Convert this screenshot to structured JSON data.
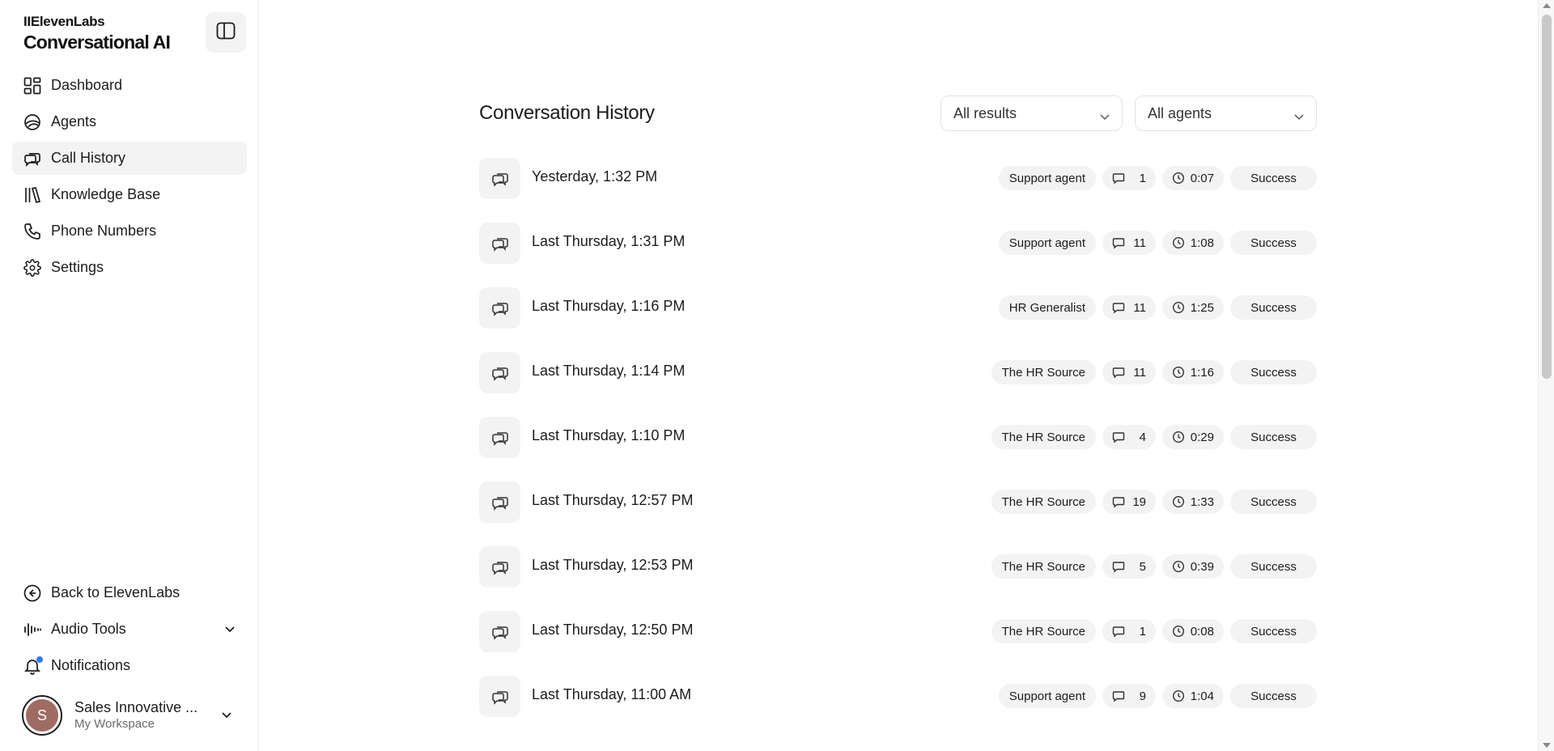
{
  "sidebar": {
    "brand_logo": "IIElevenLabs",
    "brand_product": "Conversational AI",
    "nav": [
      {
        "label": "Dashboard",
        "icon": "dashboard-icon",
        "active": false
      },
      {
        "label": "Agents",
        "icon": "agents-icon",
        "active": false
      },
      {
        "label": "Call History",
        "icon": "call-history-icon",
        "active": true
      },
      {
        "label": "Knowledge Base",
        "icon": "knowledge-base-icon",
        "active": false
      },
      {
        "label": "Phone Numbers",
        "icon": "phone-icon",
        "active": false
      },
      {
        "label": "Settings",
        "icon": "gear-icon",
        "active": false
      }
    ],
    "bottom": {
      "back": "Back to ElevenLabs",
      "audio_tools": "Audio Tools",
      "notifications": "Notifications"
    },
    "account": {
      "initial": "S",
      "name": "Sales Innovative ...",
      "workspace": "My Workspace"
    }
  },
  "main": {
    "title": "Conversation History",
    "filter_results": "All results",
    "filter_agents": "All agents",
    "conversations": [
      {
        "time": "Yesterday, 1:32 PM",
        "agent": "Support agent",
        "messages": "1",
        "duration": "0:07",
        "status": "Success"
      },
      {
        "time": "Last Thursday, 1:31 PM",
        "agent": "Support agent",
        "messages": "11",
        "duration": "1:08",
        "status": "Success"
      },
      {
        "time": "Last Thursday, 1:16 PM",
        "agent": "HR Generalist",
        "messages": "11",
        "duration": "1:25",
        "status": "Success"
      },
      {
        "time": "Last Thursday, 1:14 PM",
        "agent": "The HR Source",
        "messages": "11",
        "duration": "1:16",
        "status": "Success"
      },
      {
        "time": "Last Thursday, 1:10 PM",
        "agent": "The HR Source",
        "messages": "4",
        "duration": "0:29",
        "status": "Success"
      },
      {
        "time": "Last Thursday, 12:57 PM",
        "agent": "The HR Source",
        "messages": "19",
        "duration": "1:33",
        "status": "Success"
      },
      {
        "time": "Last Thursday, 12:53 PM",
        "agent": "The HR Source",
        "messages": "5",
        "duration": "0:39",
        "status": "Success"
      },
      {
        "time": "Last Thursday, 12:50 PM",
        "agent": "The HR Source",
        "messages": "1",
        "duration": "0:08",
        "status": "Success"
      },
      {
        "time": "Last Thursday, 11:00 AM",
        "agent": "Support agent",
        "messages": "9",
        "duration": "1:04",
        "status": "Success"
      }
    ]
  },
  "colors": {
    "pill_bg": "#f3f3f3",
    "active_nav_bg": "#f3f3f3",
    "notification_dot": "#2f7cf6",
    "avatar_bg": "#a06b62"
  }
}
